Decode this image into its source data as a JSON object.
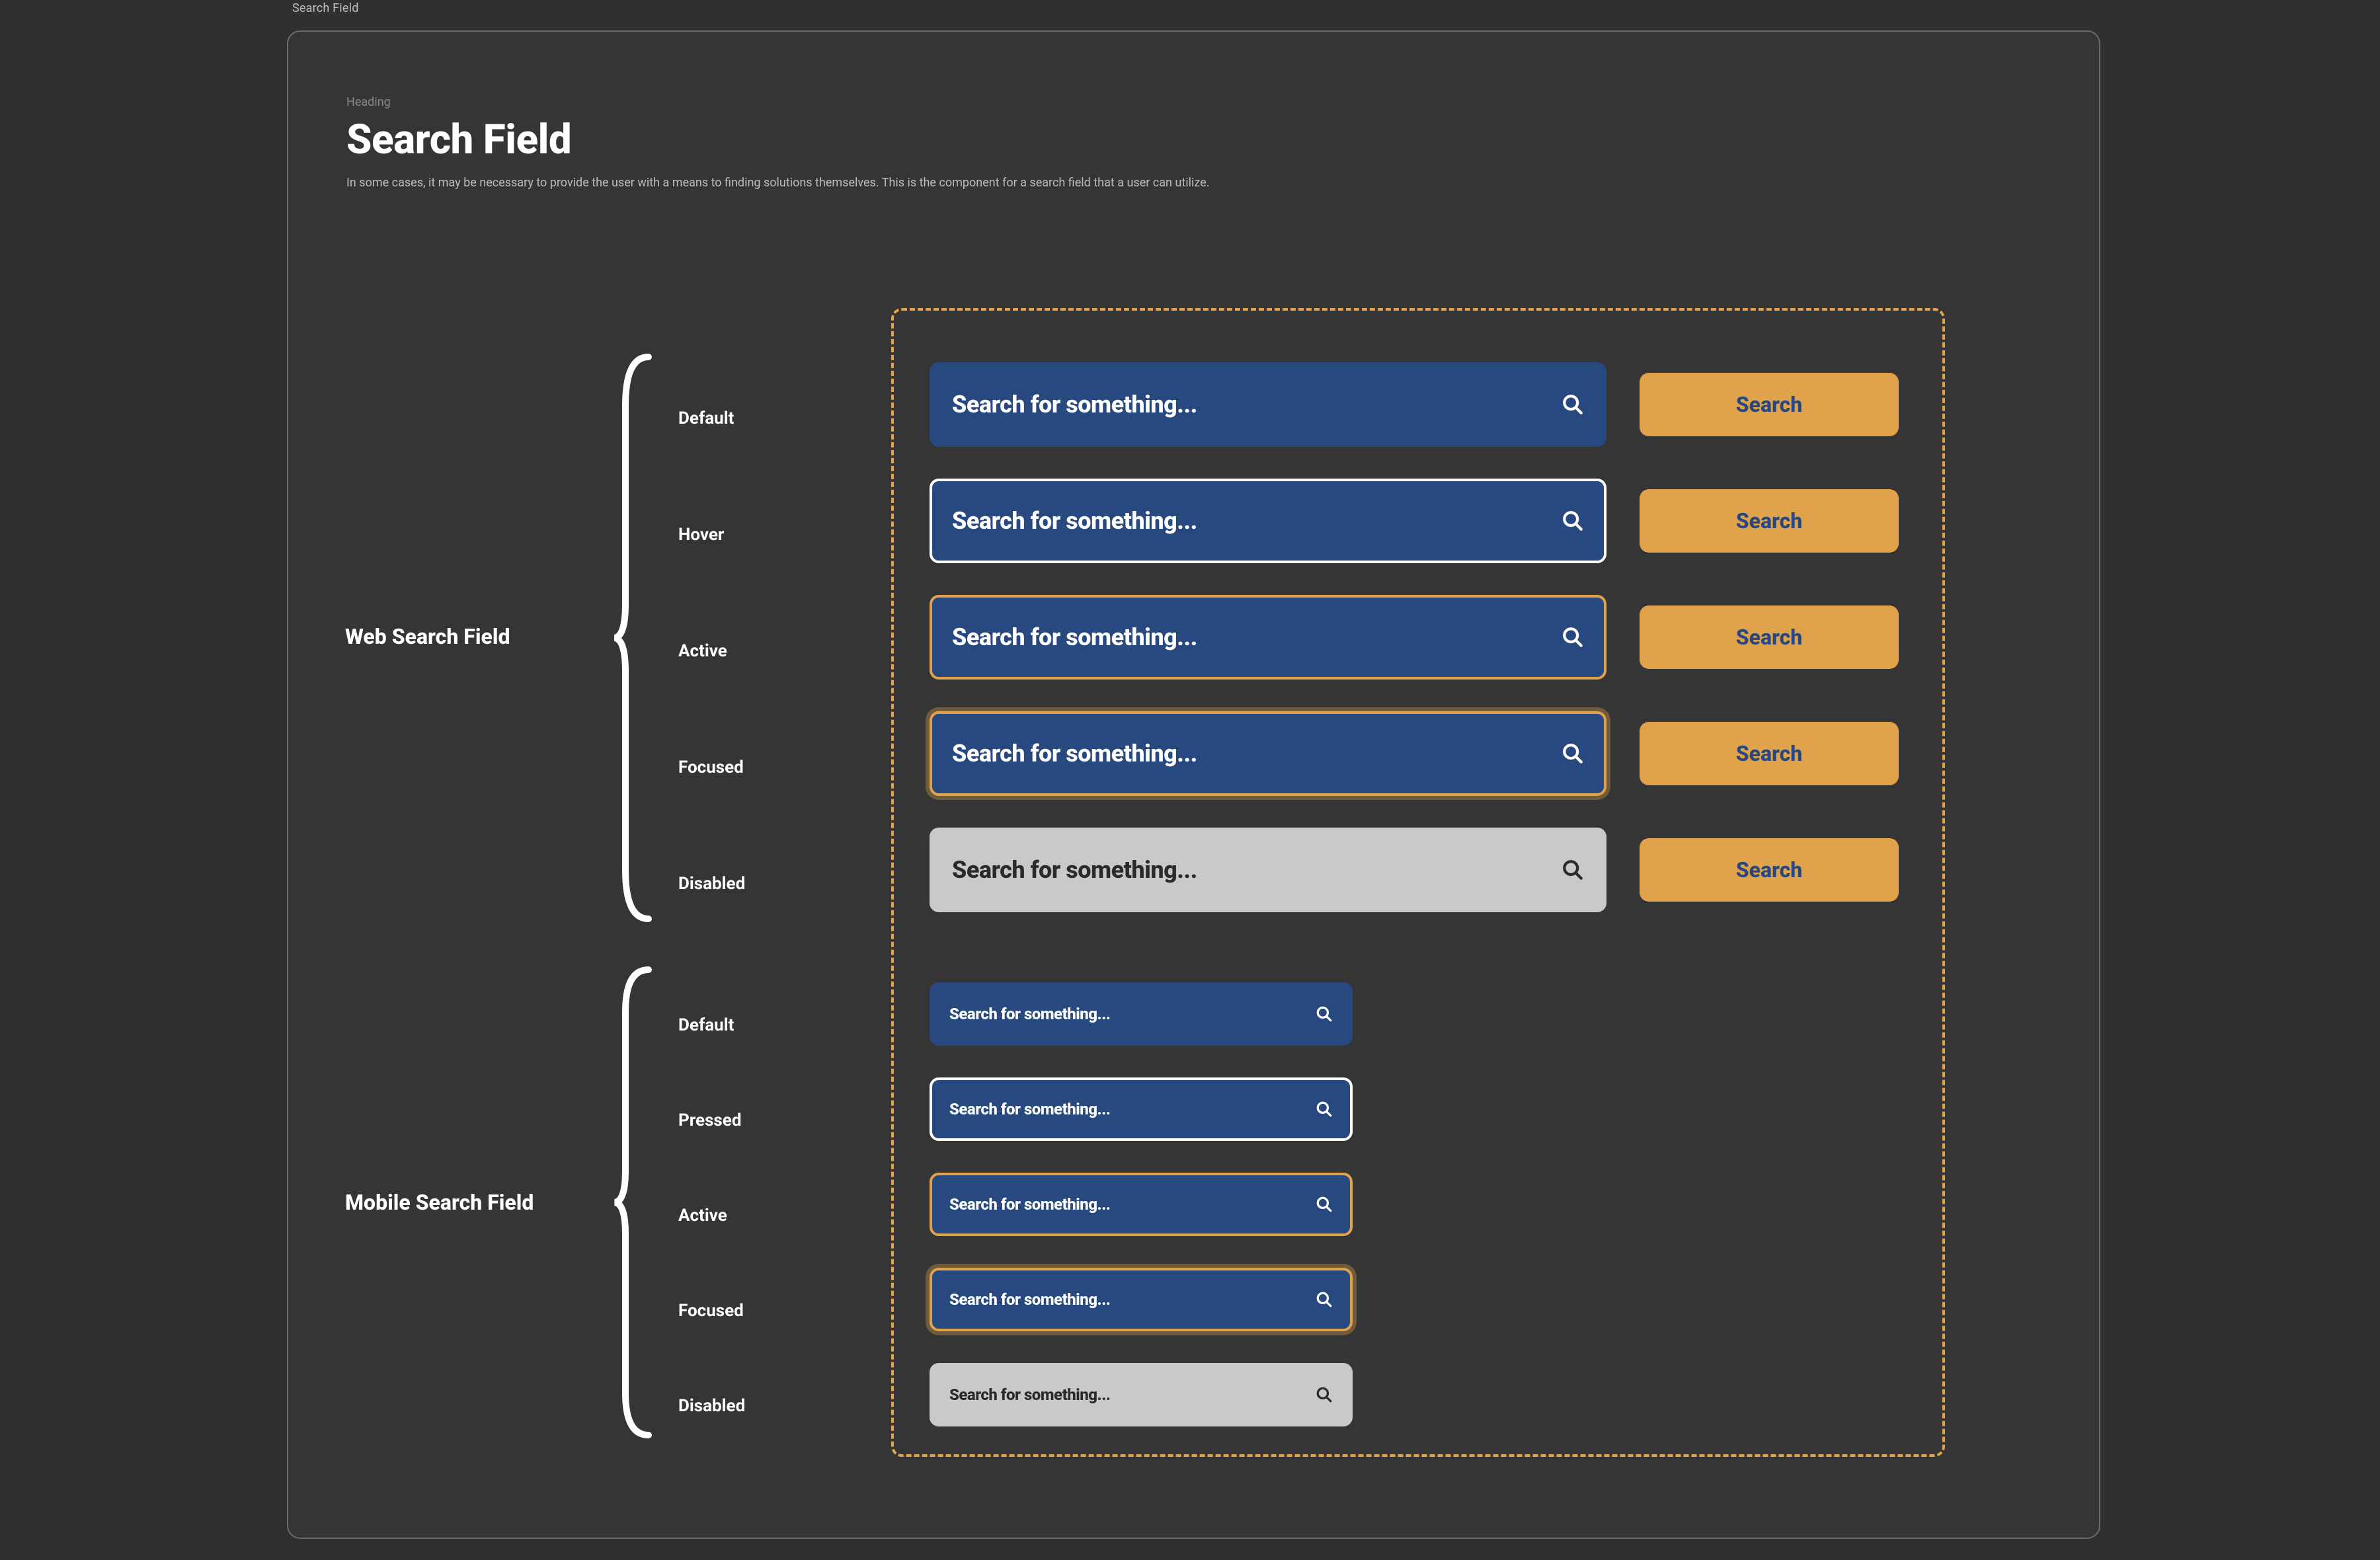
{
  "tab": "Search Field",
  "header": {
    "eyebrow": "Heading",
    "title": "Search Field",
    "description": "In some cases, it may be necessary to provide the user with a means to finding solutions themselves. This is the component for a search field that a user can utilize."
  },
  "sections": {
    "web_label": "Web Search Field",
    "mobile_label": "Mobile Search Field"
  },
  "states": {
    "web": [
      "Default",
      "Hover",
      "Active",
      "Focused",
      "Disabled"
    ],
    "mobile": [
      "Default",
      "Pressed",
      "Active",
      "Focused",
      "Disabled"
    ]
  },
  "field": {
    "placeholder": "Search for something...",
    "button_label": "Search"
  },
  "colors": {
    "accent": "#e0a34c",
    "field_bg": "#27497f",
    "disabled_bg": "#c9c9c9",
    "panel_bg": "#353535",
    "page_bg": "#303030"
  }
}
